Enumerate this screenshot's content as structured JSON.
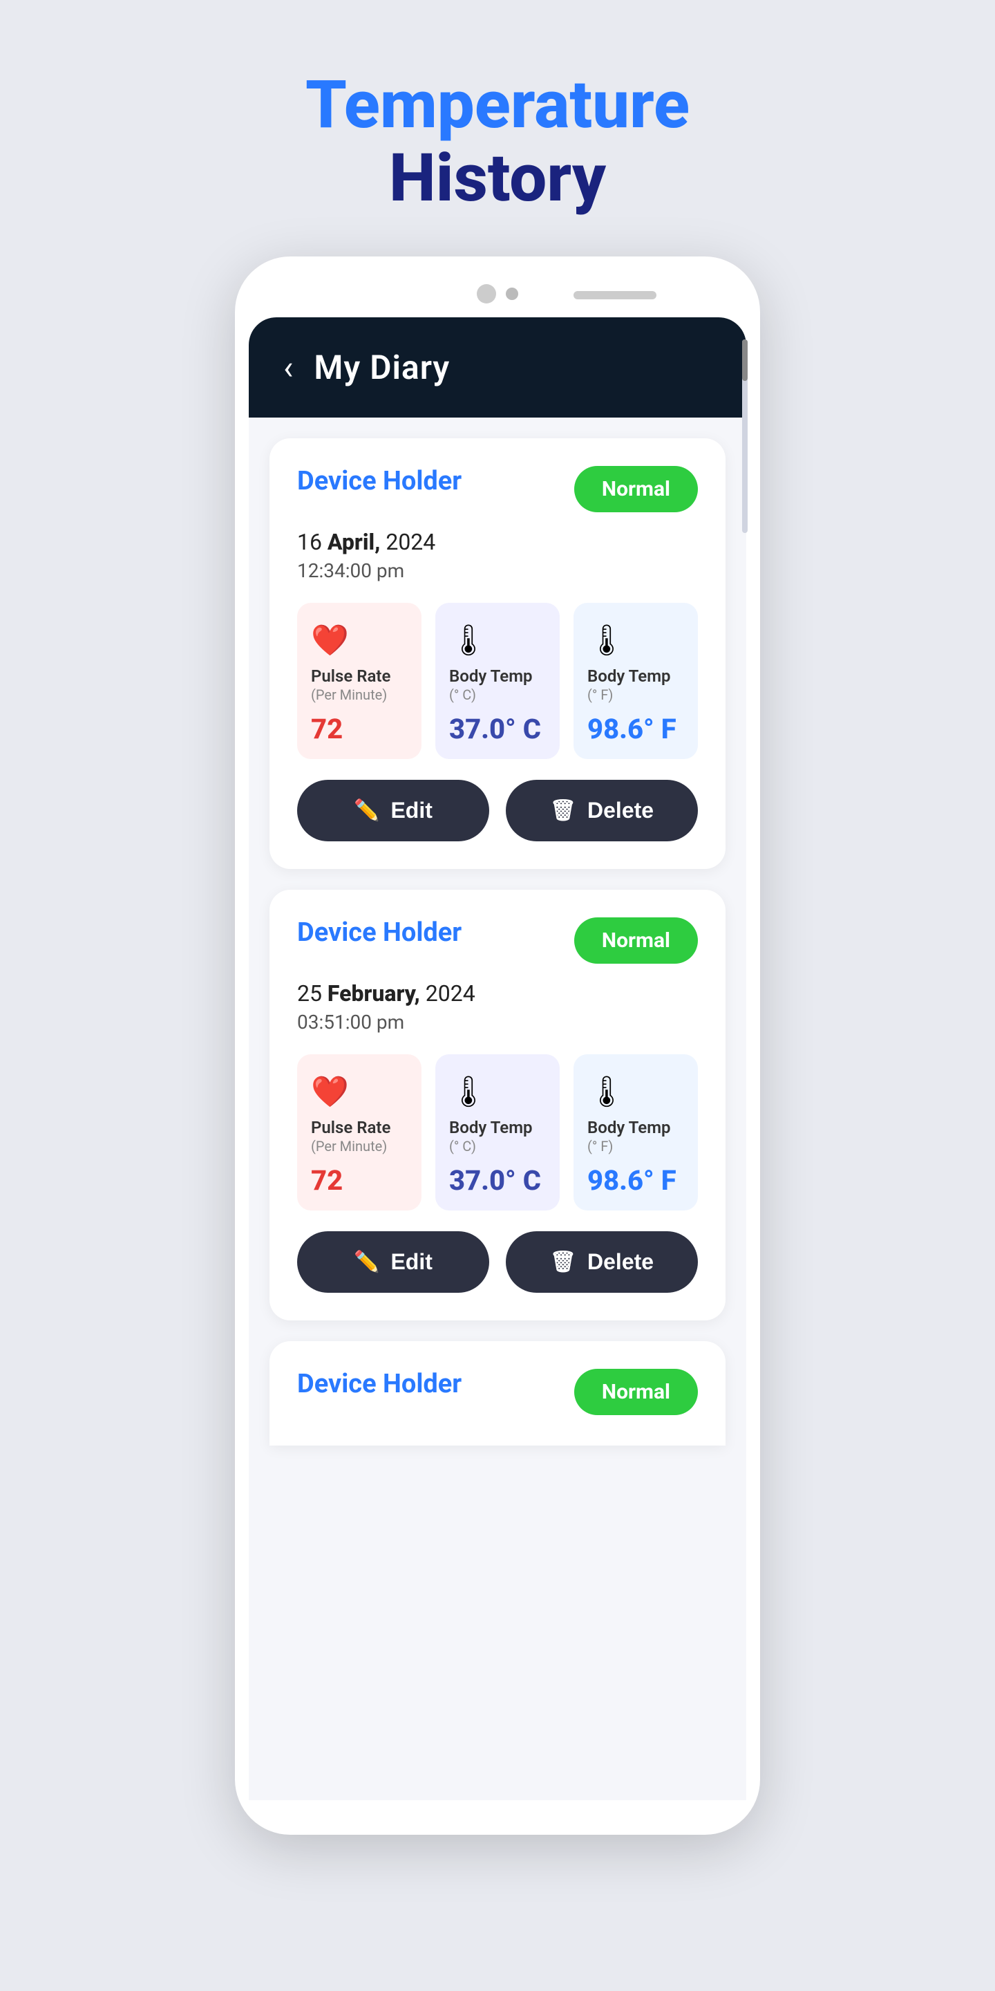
{
  "page": {
    "title_line1": "Temperature",
    "title_line2": "History"
  },
  "app": {
    "header": {
      "back_label": "‹",
      "title": "My  Diary"
    }
  },
  "entries": [
    {
      "id": "entry-1",
      "holder": "Device Holder",
      "date_prefix": "16",
      "date_bold": "April,",
      "date_year": "2024",
      "time": "12:34:00 pm",
      "status": "Normal",
      "pulse_rate": "72",
      "body_temp_c": "37.0° C",
      "body_temp_f": "98.6° F",
      "edit_label": "Edit",
      "delete_label": "Delete"
    },
    {
      "id": "entry-2",
      "holder": "Device Holder",
      "date_prefix": "25",
      "date_bold": "February,",
      "date_year": "2024",
      "time": "03:51:00 pm",
      "status": "Normal",
      "pulse_rate": "72",
      "body_temp_c": "37.0° C",
      "body_temp_f": "98.6° F",
      "edit_label": "Edit",
      "delete_label": "Delete"
    },
    {
      "id": "entry-3",
      "holder": "Device Holder",
      "date_prefix": "",
      "date_bold": "",
      "date_year": "",
      "time": "",
      "status": "Normal",
      "pulse_rate": "",
      "body_temp_c": "",
      "body_temp_f": "",
      "edit_label": "",
      "delete_label": ""
    }
  ],
  "labels": {
    "pulse_label": "Pulse Rate",
    "pulse_sub": "(Per Minute)",
    "body_temp_c_label": "Body Temp",
    "body_temp_c_sub": "(° C)",
    "body_temp_f_label": "Body Temp",
    "body_temp_f_sub": "(° F)"
  },
  "colors": {
    "accent_blue": "#2979ff",
    "accent_dark": "#1a237e",
    "green": "#2ecc40",
    "dark_header": "#0d1b2a",
    "pulse_red": "#e53935",
    "temp_c_blue": "#3949ab",
    "temp_f_blue": "#2979ff"
  }
}
